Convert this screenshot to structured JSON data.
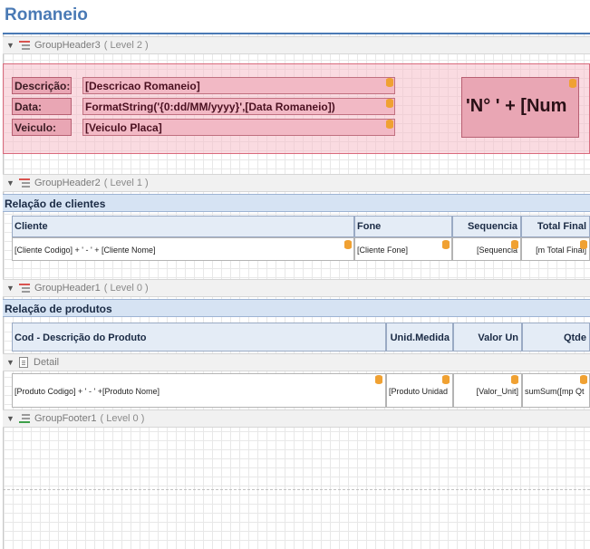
{
  "report": {
    "title": "Romaneio"
  },
  "bands": {
    "group_header3": {
      "name": "GroupHeader3",
      "level": "( Level 2 )"
    },
    "group_header2": {
      "name": "GroupHeader2",
      "level": "( Level 1 )"
    },
    "group_header1": {
      "name": "GroupHeader1",
      "level": "( Level 0 )"
    },
    "detail": {
      "name": "Detail"
    },
    "group_footer1": {
      "name": "GroupFooter1",
      "level": "( Level 0 )"
    }
  },
  "header_fields": {
    "descricao_label": "Descrição:",
    "data_label": "Data:",
    "veiculo_label": "Veiculo:",
    "descricao_value": "[Descricao Romaneio]",
    "data_value": "FormatString('{0:dd/MM/yyyy}',[Data Romaneio])",
    "veiculo_value": "[Veiculo Placa]",
    "numero_expr": "'N° ' + [Num"
  },
  "clients": {
    "section_title": "Relação de clientes",
    "columns": [
      "Cliente",
      "Fone",
      "Sequencia",
      "Total Final"
    ],
    "row": [
      "[Cliente Codigo] + ' - ' + [Cliente Nome]",
      "[Cliente Fone]",
      "[Sequencia",
      "[m Total Final]"
    ]
  },
  "products": {
    "section_title": "Relação de produtos",
    "columns": [
      "Cod - Descrição do Produto",
      "Unid.Medida",
      "Valor Un",
      "Qtde"
    ],
    "row": [
      "[Produto Codigo] + ' - ' +[Produto Nome]",
      "[Produto Unidad",
      "[Valor_Unit]",
      "sumSum([mp Qt"
    ]
  },
  "colors": {
    "accent": "#4a7ab5",
    "pink_panel": "#f5bec8",
    "table_header": "#d6e3f3",
    "db_icon": "#f0a132"
  },
  "icons": [
    "collapse-arrow-icon",
    "group-header-icon",
    "detail-band-icon",
    "group-footer-icon",
    "database-field-icon"
  ]
}
